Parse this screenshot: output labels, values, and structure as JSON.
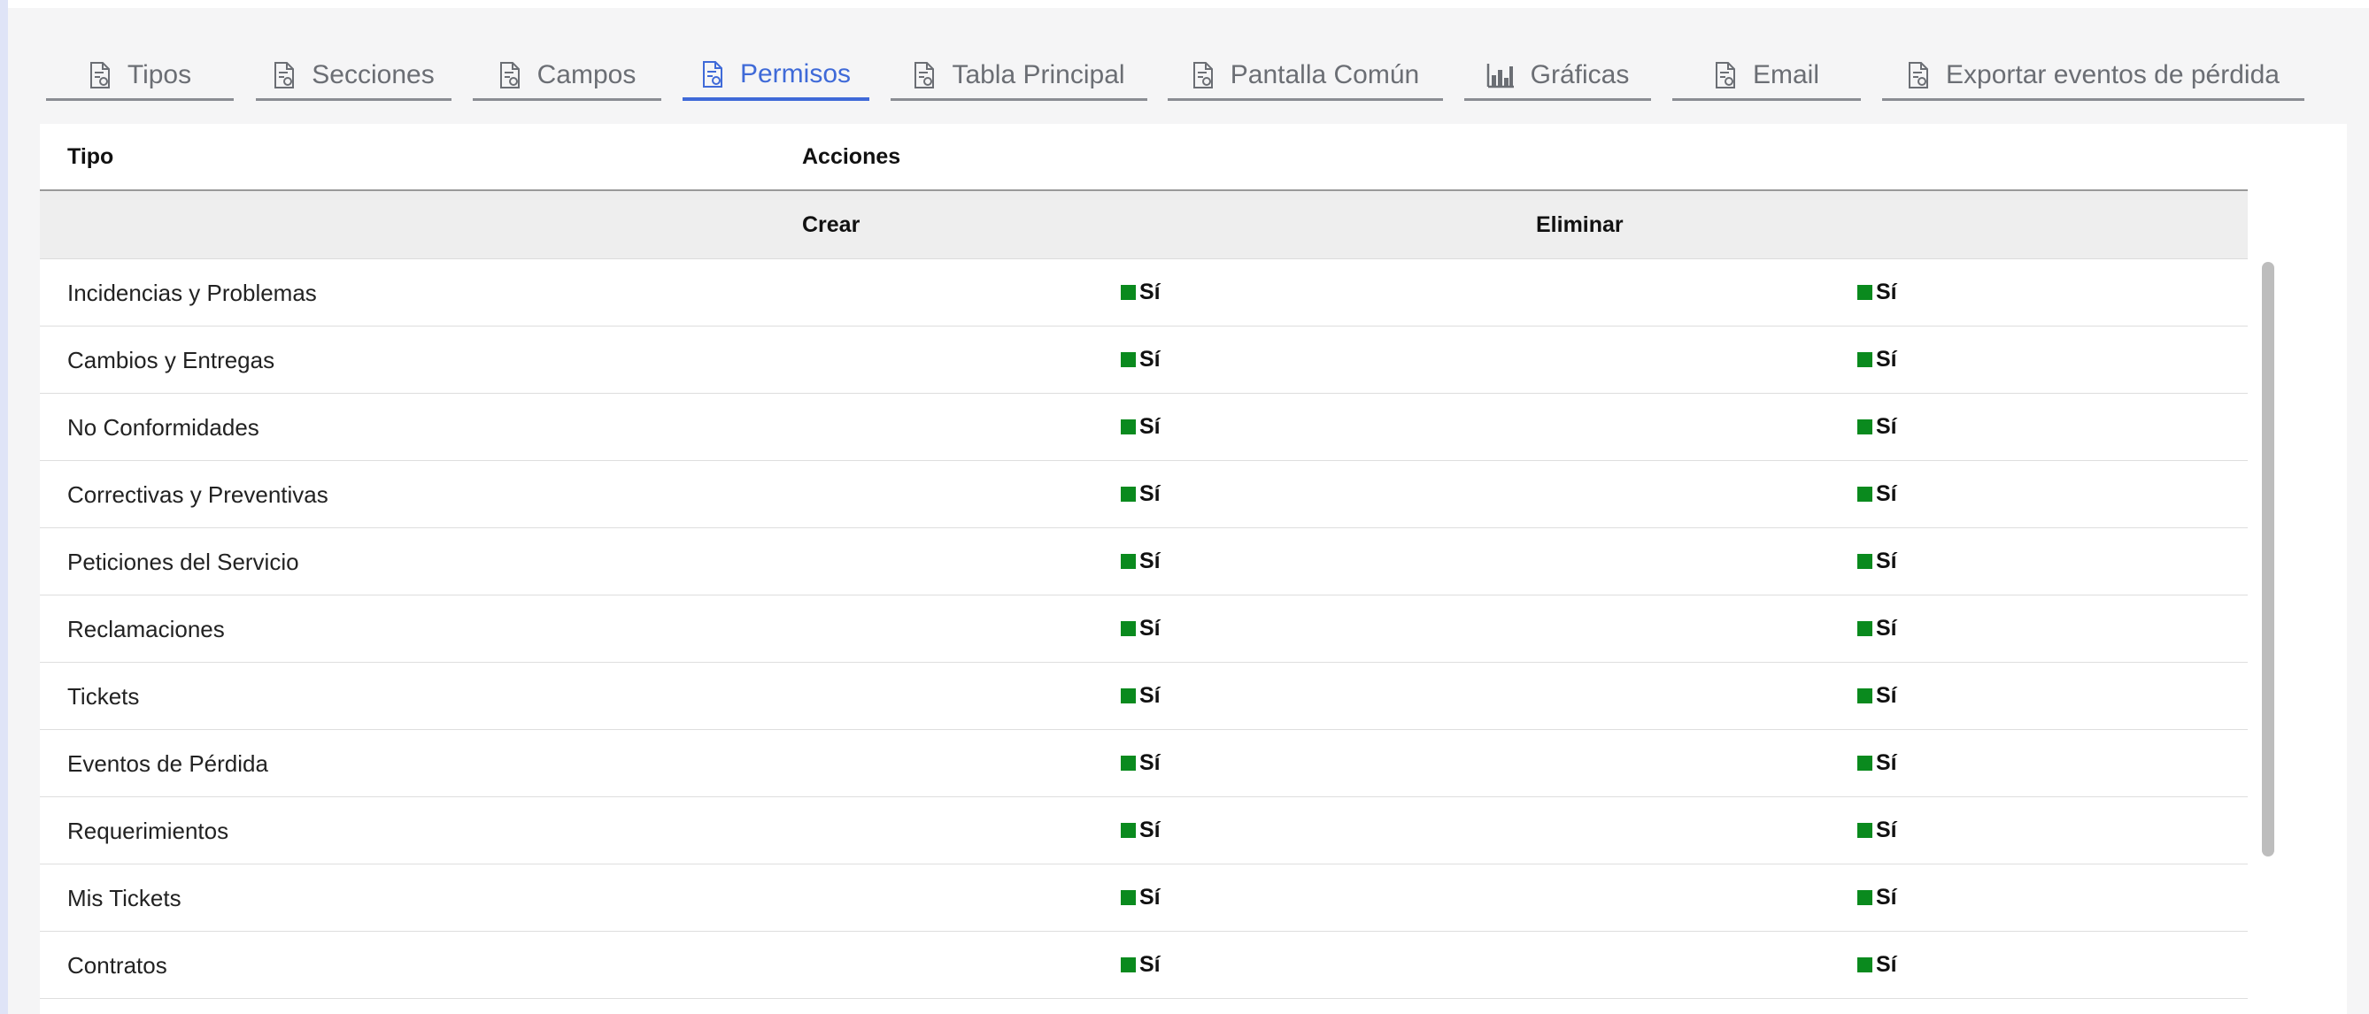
{
  "tabs": [
    {
      "label": "Tipos",
      "icon": "document-icon",
      "active": false
    },
    {
      "label": "Secciones",
      "icon": "document-icon",
      "active": false
    },
    {
      "label": "Campos",
      "icon": "document-icon",
      "active": false
    },
    {
      "label": "Permisos",
      "icon": "document-icon",
      "active": true
    },
    {
      "label": "Tabla Principal",
      "icon": "document-icon",
      "active": false
    },
    {
      "label": "Pantalla Común",
      "icon": "document-icon",
      "active": false
    },
    {
      "label": "Gráficas",
      "icon": "bar-chart-icon",
      "active": false
    },
    {
      "label": "Email",
      "icon": "document-icon",
      "active": false
    },
    {
      "label": "Exportar eventos de pérdida",
      "icon": "document-icon",
      "active": false
    }
  ],
  "table": {
    "header_tipo": "Tipo",
    "header_acciones": "Acciones",
    "sub_crear": "Crear",
    "sub_eliminar": "Eliminar",
    "rows": [
      {
        "tipo": "Incidencias y Problemas",
        "crear": "Sí",
        "eliminar": "Sí"
      },
      {
        "tipo": "Cambios y Entregas",
        "crear": "Sí",
        "eliminar": "Sí"
      },
      {
        "tipo": "No Conformidades",
        "crear": "Sí",
        "eliminar": "Sí"
      },
      {
        "tipo": "Correctivas y Preventivas",
        "crear": "Sí",
        "eliminar": "Sí"
      },
      {
        "tipo": "Peticiones del Servicio",
        "crear": "Sí",
        "eliminar": "Sí"
      },
      {
        "tipo": "Reclamaciones",
        "crear": "Sí",
        "eliminar": "Sí"
      },
      {
        "tipo": "Tickets",
        "crear": "Sí",
        "eliminar": "Sí"
      },
      {
        "tipo": "Eventos de Pérdida",
        "crear": "Sí",
        "eliminar": "Sí"
      },
      {
        "tipo": "Requerimientos",
        "crear": "Sí",
        "eliminar": "Sí"
      },
      {
        "tipo": "Mis Tickets",
        "crear": "Sí",
        "eliminar": "Sí"
      },
      {
        "tipo": "Contratos",
        "crear": "Sí",
        "eliminar": "Sí"
      }
    ]
  },
  "colors": {
    "accent": "#3f6ad8",
    "tab_inactive": "#6b6e74",
    "yes_marker": "#0a8a1e"
  }
}
